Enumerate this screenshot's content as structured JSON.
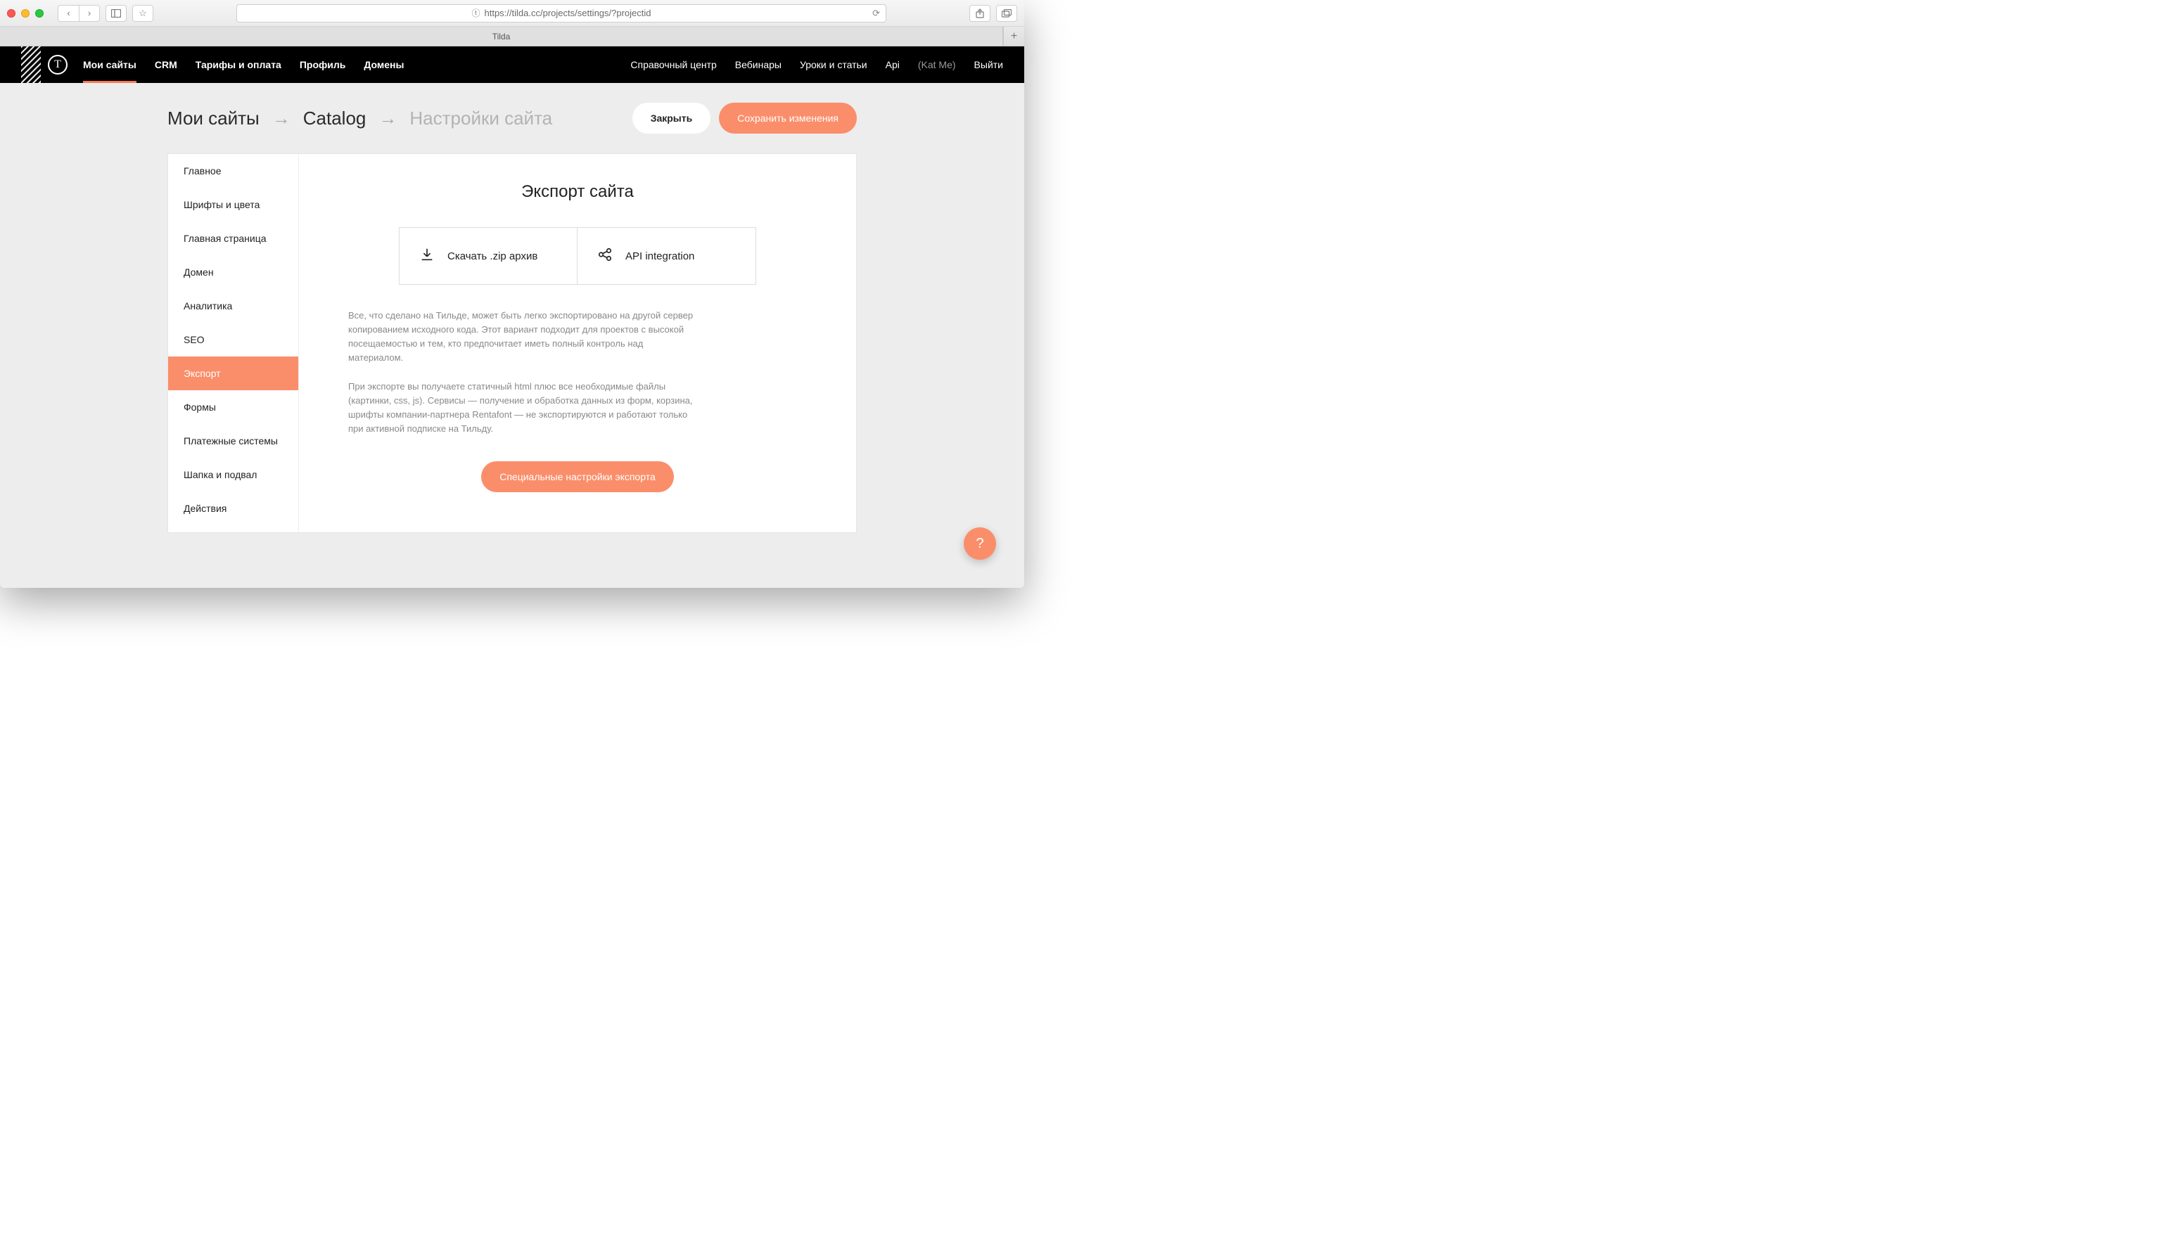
{
  "browser": {
    "url": "https://tilda.cc/projects/settings/?projectid",
    "tab_title": "Tilda"
  },
  "topnav": {
    "logo_letter": "T",
    "left": [
      {
        "label": "Мои сайты",
        "active": true
      },
      {
        "label": "CRM"
      },
      {
        "label": "Тарифы и оплата"
      },
      {
        "label": "Профиль"
      },
      {
        "label": "Домены"
      }
    ],
    "right": [
      {
        "label": "Справочный центр"
      },
      {
        "label": "Вебинары"
      },
      {
        "label": "Уроки и статьи"
      },
      {
        "label": "Api"
      }
    ],
    "user": "(Kat Me)",
    "logout": "Выйти"
  },
  "breadcrumb": {
    "root": "Мои сайты",
    "project": "Catalog",
    "current": "Настройки сайта"
  },
  "actions": {
    "close": "Закрыть",
    "save": "Сохранить изменения"
  },
  "sidebar": [
    "Главное",
    "Шрифты и цвета",
    "Главная страница",
    "Домен",
    "Аналитика",
    "SEO",
    "Экспорт",
    "Формы",
    "Платежные системы",
    "Шапка и подвал",
    "Действия"
  ],
  "sidebar_active_index": 6,
  "content": {
    "title": "Экспорт сайта",
    "card_zip": "Скачать .zip архив",
    "card_api": "API integration",
    "para1": "Все, что сделано на Тильде, может быть легко экспортировано на другой сервер копированием исходного кода. Этот вариант подходит для проектов с высокой посещаемостью и тем, кто предпочитает иметь полный контроль над материалом.",
    "para2": "При экспорте вы получаете статичный html плюс все необходимые файлы (картинки, css, js). Сервисы — получение и обработка данных из форм, корзина, шрифты компании-партнера Rentafont — не экспортируются и работают только при активной подписке на Тильду.",
    "special_btn": "Специальные настройки экспорта"
  },
  "help_label": "?"
}
